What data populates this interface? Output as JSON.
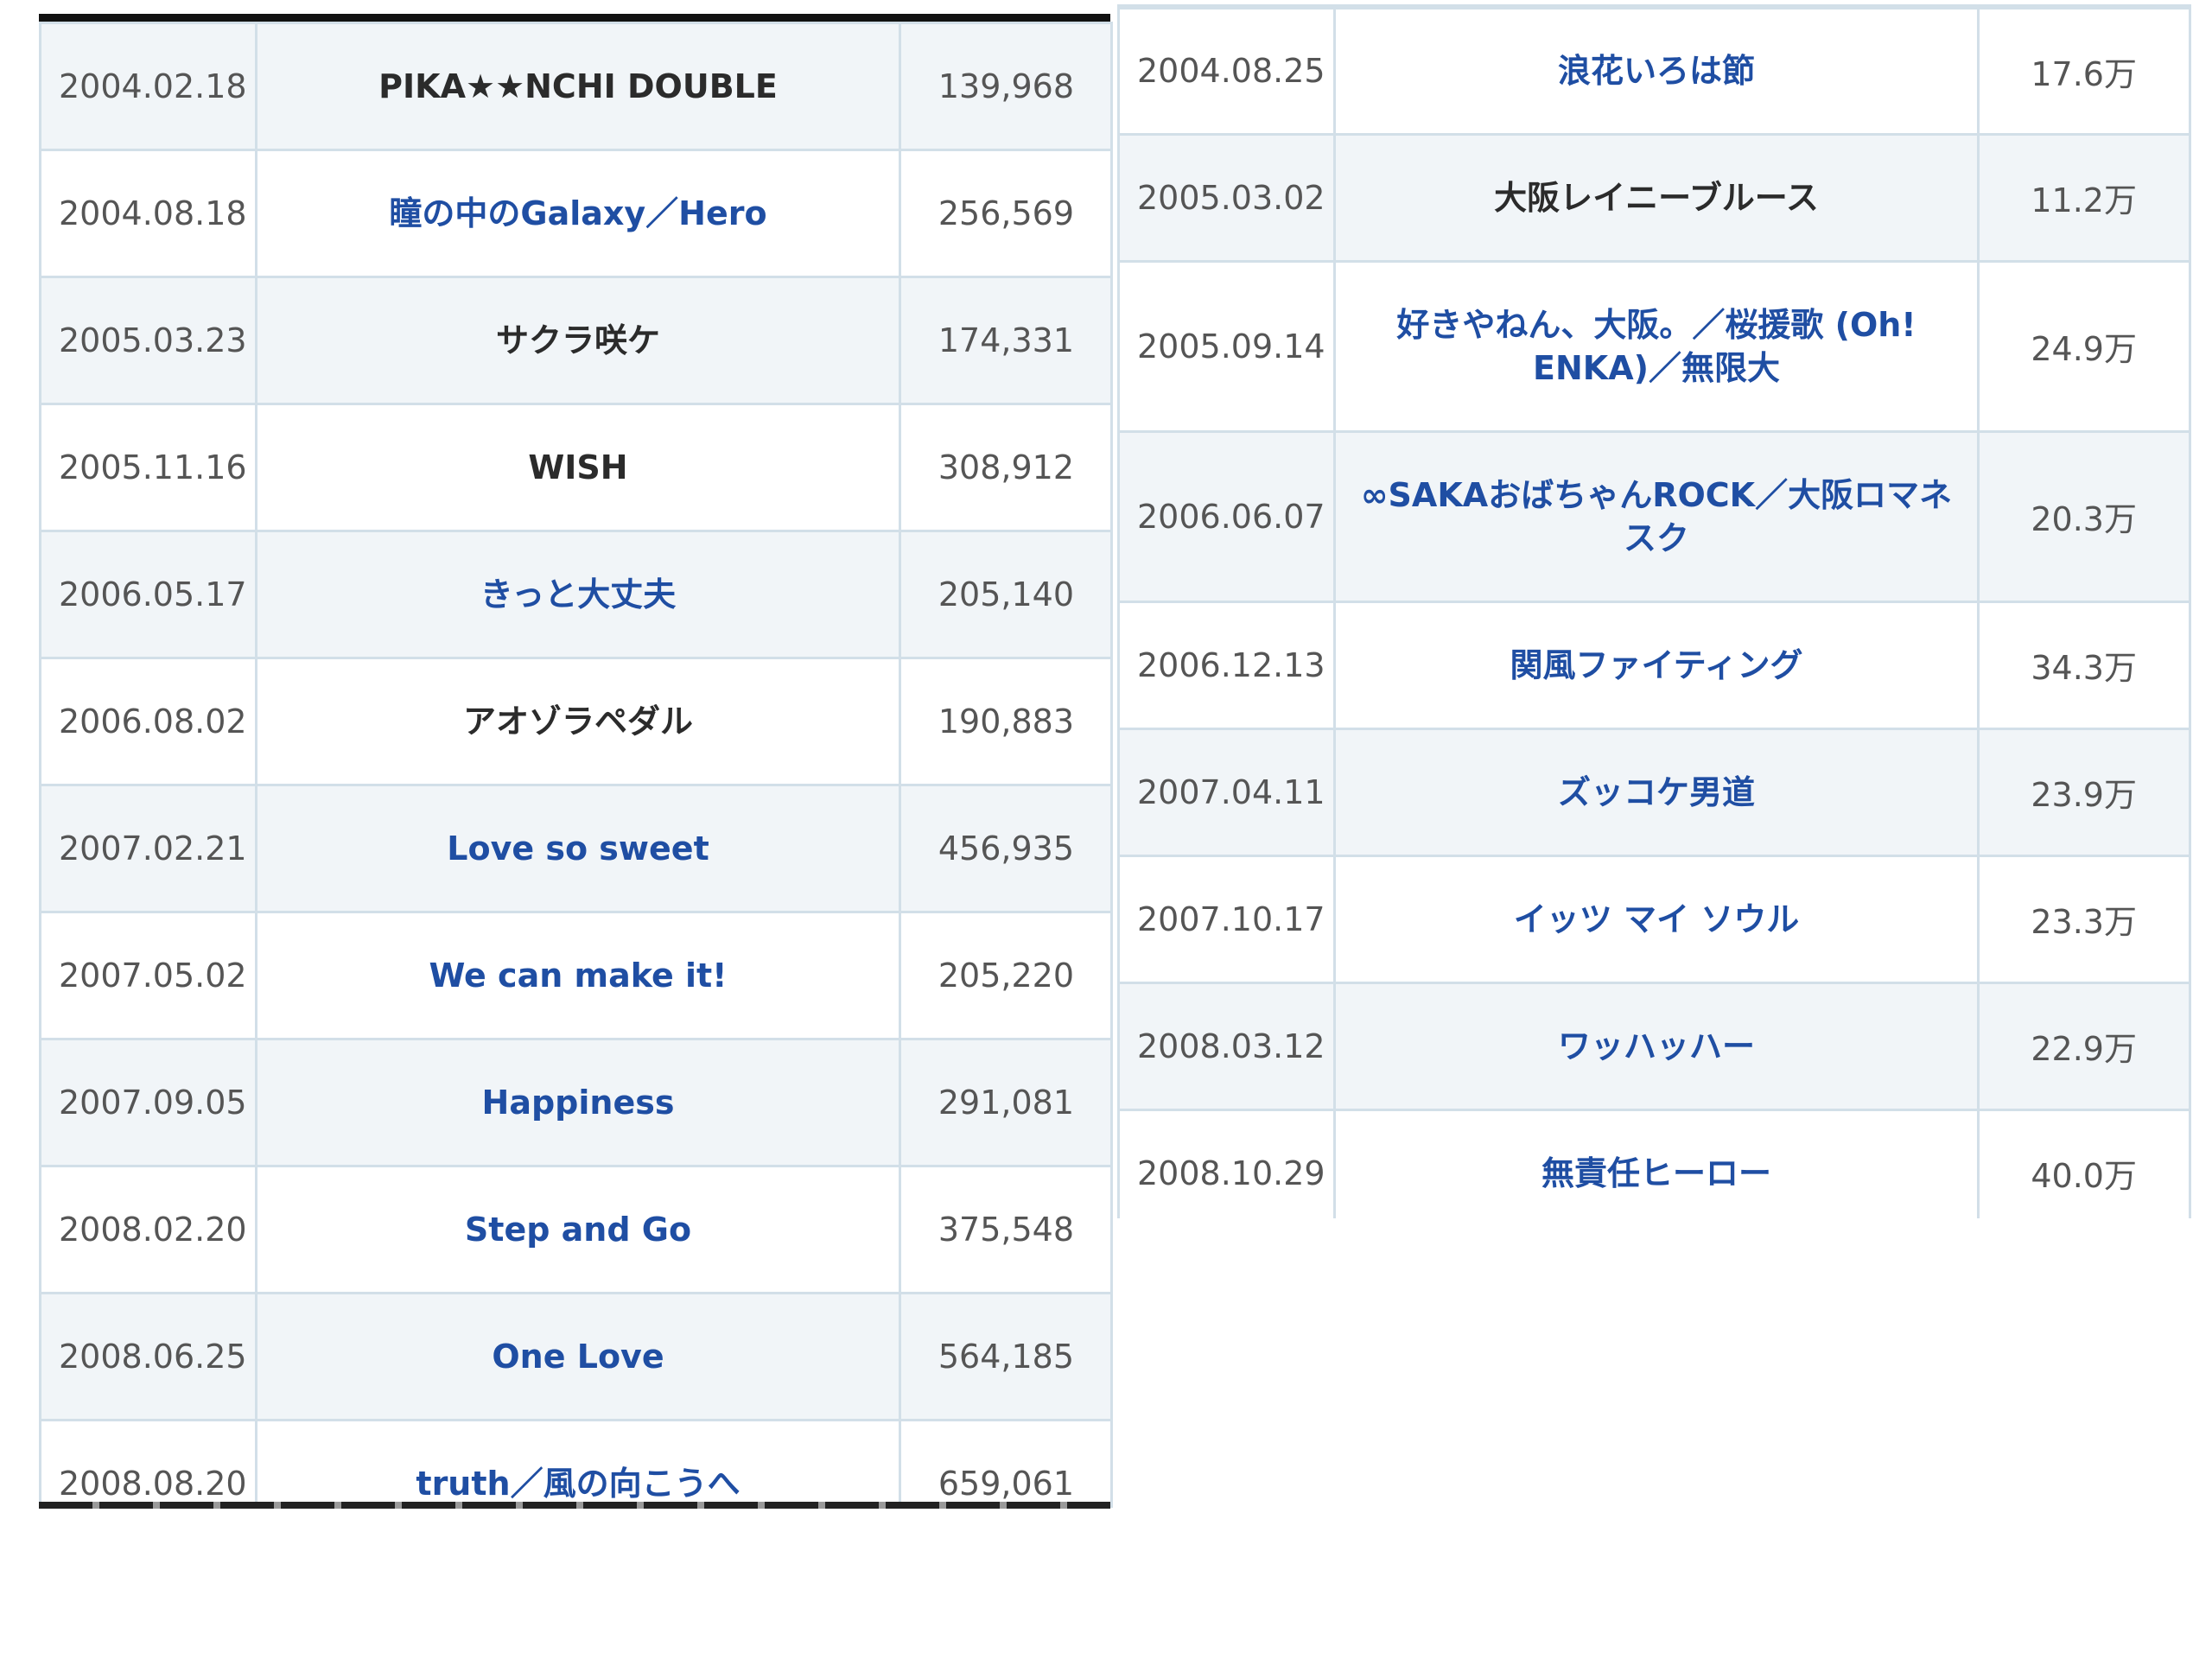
{
  "left_table": {
    "rows": [
      {
        "date": "2004.02.18",
        "title": "PIKA★★NCHI DOUBLE",
        "sales": "139,968",
        "link": false
      },
      {
        "date": "2004.08.18",
        "title": "瞳の中のGalaxy／Hero",
        "sales": "256,569",
        "link": true
      },
      {
        "date": "2005.03.23",
        "title": "サクラ咲ケ",
        "sales": "174,331",
        "link": false
      },
      {
        "date": "2005.11.16",
        "title": "WISH",
        "sales": "308,912",
        "link": false
      },
      {
        "date": "2006.05.17",
        "title": "きっと大丈夫",
        "sales": "205,140",
        "link": true
      },
      {
        "date": "2006.08.02",
        "title": "アオゾラペダル",
        "sales": "190,883",
        "link": false
      },
      {
        "date": "2007.02.21",
        "title": "Love so sweet",
        "sales": "456,935",
        "link": true
      },
      {
        "date": "2007.05.02",
        "title": "We can make it!",
        "sales": "205,220",
        "link": true
      },
      {
        "date": "2007.09.05",
        "title": "Happiness",
        "sales": "291,081",
        "link": true
      },
      {
        "date": "2008.02.20",
        "title": "Step and Go",
        "sales": "375,548",
        "link": true
      },
      {
        "date": "2008.06.25",
        "title": "One Love",
        "sales": "564,185",
        "link": true
      },
      {
        "date": "2008.08.20",
        "title": "truth／風の向こうへ",
        "sales": "659,061",
        "link": true
      }
    ]
  },
  "right_table": {
    "rows": [
      {
        "date": "2004.08.25",
        "title": "浪花いろは節",
        "sales": "17.6万",
        "link": true
      },
      {
        "date": "2005.03.02",
        "title": "大阪レイニーブルース",
        "sales": "11.2万",
        "link": false
      },
      {
        "date": "2005.09.14",
        "title": "好きやねん、大阪。／桜援歌 (Oh! ENKA)／無限大",
        "sales": "24.9万",
        "link": true
      },
      {
        "date": "2006.06.07",
        "title": "∞SAKAおばちゃんROCK／大阪ロマネスク",
        "sales": "20.3万",
        "link": true
      },
      {
        "date": "2006.12.13",
        "title": "関風ファイティング",
        "sales": "34.3万",
        "link": true
      },
      {
        "date": "2007.04.11",
        "title": "ズッコケ男道",
        "sales": "23.9万",
        "link": true
      },
      {
        "date": "2007.10.17",
        "title": "イッツ マイ ソウル",
        "sales": "23.3万",
        "link": true
      },
      {
        "date": "2008.03.12",
        "title": "ワッハッハー",
        "sales": "22.9万",
        "link": true
      },
      {
        "date": "2008.10.29",
        "title": "無責任ヒーロー",
        "sales": "40.0万",
        "link": true
      }
    ]
  },
  "colors": {
    "link": "#1f4ea3",
    "plain_title": "#2b2b2b",
    "row_shaded": "#f1f5f8",
    "border": "#d2dfe8"
  }
}
